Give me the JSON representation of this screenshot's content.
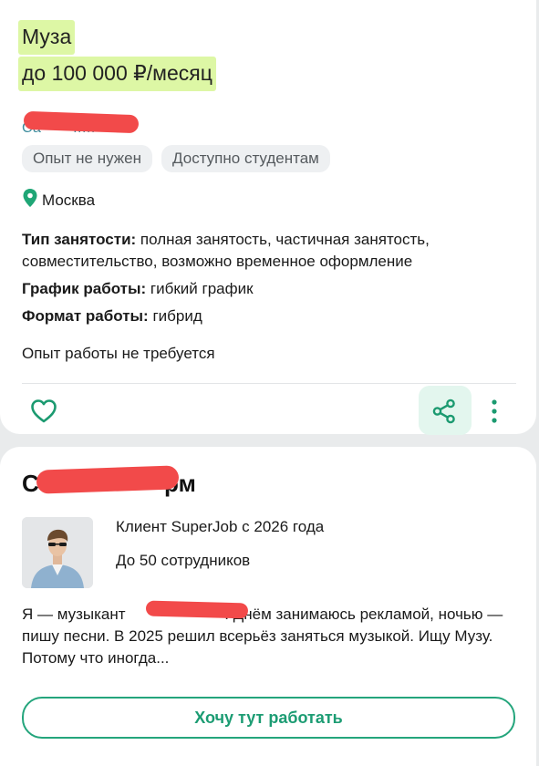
{
  "vacancy": {
    "title": "Муза",
    "salary": "до 100 000 ₽/месяц",
    "tags": [
      "Опыт не нужен",
      "Доступно студентам"
    ],
    "location": "Москва",
    "employment_type_label": "Тип занятости:",
    "employment_type_value": " полная занятость, частичная занятость, совместительство, возможно временное оформление",
    "schedule_label": "График работы:",
    "schedule_value": " гибкий график",
    "format_label": "Формат работы:",
    "format_value": " гибрид",
    "experience": "Опыт работы не требуется"
  },
  "actions": {
    "favorite_icon": "heart-icon",
    "share_icon": "share-icon",
    "more_icon": "more-vertical-icon"
  },
  "company": {
    "client_since": "Клиент SuperJob с 2026 года",
    "employees": "До 50 сотрудников",
    "about_part1": "Я — музыкант ",
    "about_part2": ". Днём занимаюсь рекламой, ночью — пишу песни. В 2025 решил всерьёз заняться музыкой. Ищу Музу. Потому что иногда...",
    "cta_label": "Хочу тут работать"
  },
  "colors": {
    "highlight": "#ddf7a5",
    "accent": "#24a57c",
    "tag_bg": "#eef0f2",
    "redaction": "#f24a4a"
  }
}
